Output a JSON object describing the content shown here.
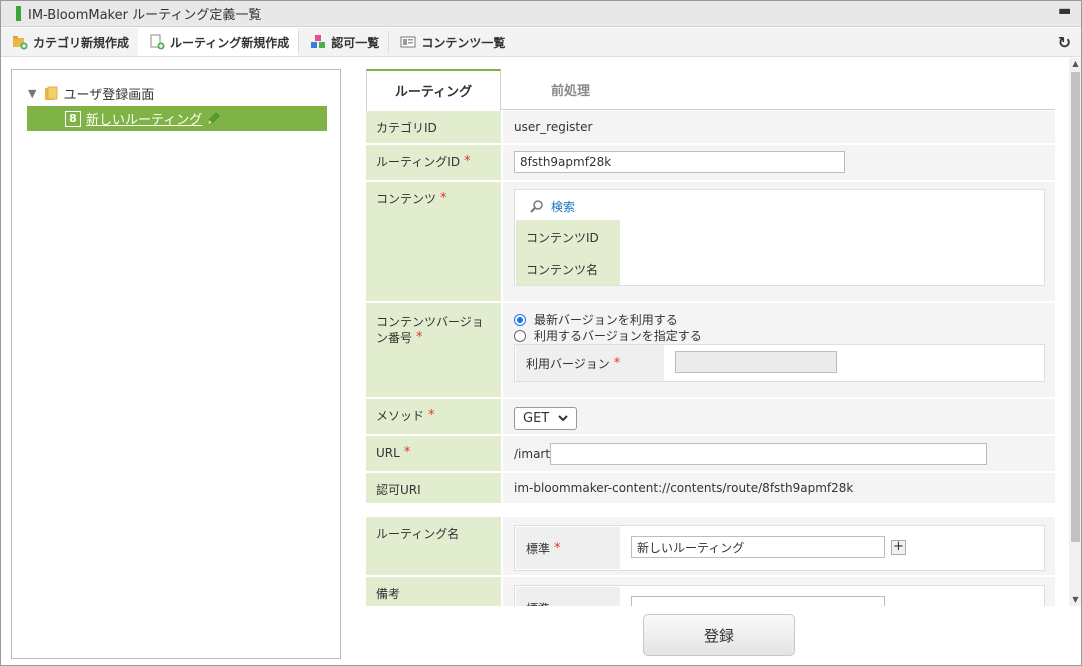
{
  "window": {
    "title": "IM-BloomMaker ルーティング定義一覧"
  },
  "toolbar": {
    "items": [
      {
        "label": "カテゴリ新規作成",
        "icon": "category-add-icon"
      },
      {
        "label": "ルーティング新規作成",
        "icon": "routing-add-icon"
      },
      {
        "label": "認可一覧",
        "icon": "authorization-list-icon"
      },
      {
        "label": "コンテンツ一覧",
        "icon": "content-list-icon"
      }
    ],
    "reload_icon": "reload-icon"
  },
  "tree": {
    "root_label": "ユーザ登録画面",
    "node_label": "新しいルーティング",
    "node_badge": "8"
  },
  "tabs": [
    {
      "label": "ルーティング"
    },
    {
      "label": "前処理"
    }
  ],
  "form": {
    "category_id": {
      "label": "カテゴリID",
      "value": "user_register"
    },
    "routing_id": {
      "label": "ルーティングID",
      "value": "8fsth9apmf28k"
    },
    "contents": {
      "label": "コンテンツ",
      "search_label": "検索",
      "id_label": "コンテンツID",
      "name_label": "コンテンツ名"
    },
    "version": {
      "label": "コンテンツバージョン番号",
      "option_latest": "最新バージョンを利用する",
      "option_specify": "利用するバージョンを指定する",
      "use_version_label": "利用バージョン",
      "use_version_value": ""
    },
    "method": {
      "label": "メソッド",
      "value": "GET"
    },
    "url": {
      "label": "URL",
      "prefix": "/imart/",
      "value": ""
    },
    "auth_uri": {
      "label": "認可URI",
      "value": "im-bloommaker-content://contents/route/8fsth9apmf28k"
    },
    "routing_name": {
      "label": "ルーティング名",
      "locale_label": "標準",
      "value": "新しいルーティング"
    },
    "remarks": {
      "label": "備考",
      "locale_label": "標準",
      "value": ""
    },
    "required_mark": "*"
  },
  "buttons": {
    "register": "登録"
  },
  "colors": {
    "accent_green": "#7fb346",
    "label_bg": "#e2eccf",
    "required": "#e0362c",
    "link": "#1a73b8"
  }
}
